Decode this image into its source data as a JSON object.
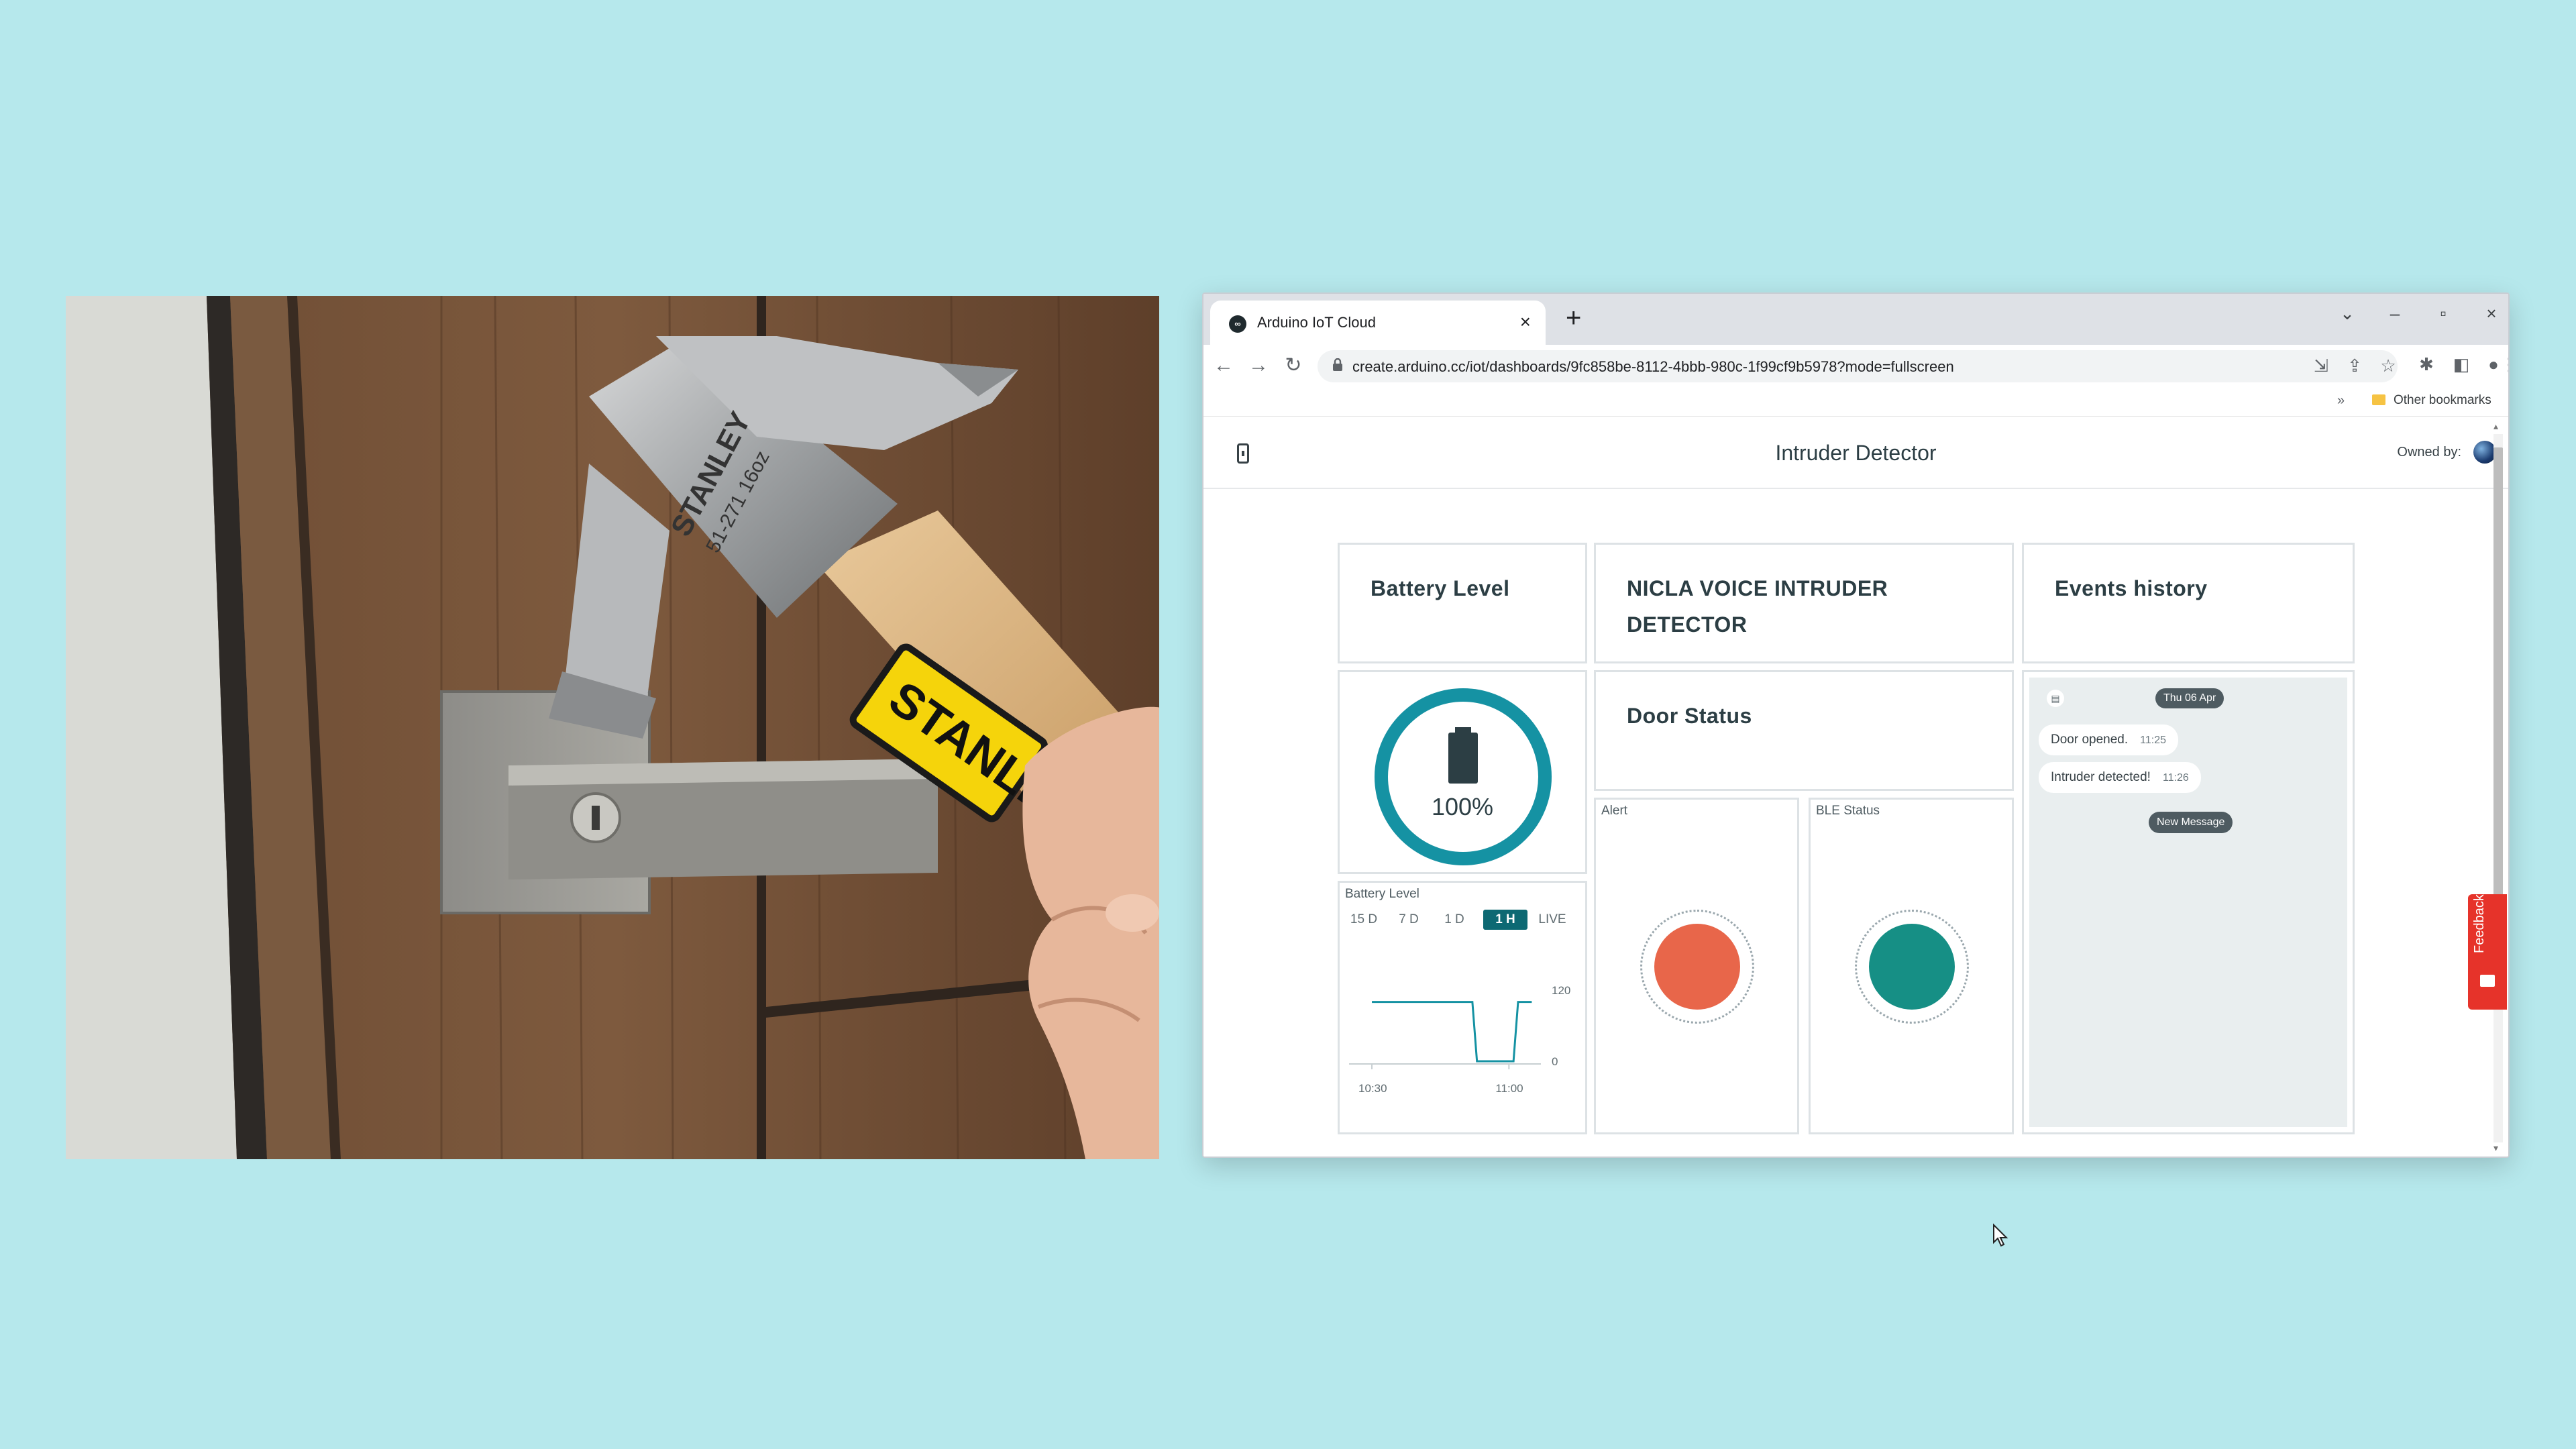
{
  "browser": {
    "tab_title": "Arduino IoT Cloud",
    "url": "create.arduino.cc/iot/dashboards/9fc858be-8112-4bbb-980c-1f99cf9b5978?mode=fullscreen",
    "bookmarks_label": "Other bookmarks"
  },
  "dashboard": {
    "title": "Intruder Detector",
    "owned_by": "Owned by:",
    "cards": {
      "battery_title": "Battery Level",
      "nicla_title": "NICLA VOICE INTRUDER DETECTOR",
      "events_title": "Events history",
      "door_title": "Door Status"
    },
    "gauge": {
      "value_label": "100%",
      "value": 1.0
    },
    "battery_chart": {
      "label": "Battery Level",
      "timeframes": [
        "15 D",
        "7 D",
        "1 D",
        "1 H",
        "LIVE"
      ],
      "active_timeframe": "1 H"
    },
    "alert": {
      "label": "Alert",
      "color": "#e8664a"
    },
    "ble": {
      "label": "BLE Status",
      "color": "#168f85"
    },
    "events": {
      "date": "Thu 06 Apr",
      "messages": [
        {
          "text": "Door opened.",
          "time": "11:25"
        },
        {
          "text": "Intruder detected!",
          "time": "11:26"
        }
      ],
      "new_message": "New Message"
    },
    "feedback_label": "Feedback"
  },
  "photo": {
    "hammer_text": "STANLE",
    "hammer_head_text": "STANLEY",
    "hammer_model": "51-271 16oz"
  },
  "chart_data": {
    "type": "line",
    "title": "Battery Level",
    "x_ticks": [
      "10:30",
      "11:00"
    ],
    "y_ticks": [
      120,
      0
    ],
    "ylim": [
      0,
      120
    ],
    "series": [
      {
        "x": [
          "10:30",
          "10:48",
          "10:52",
          "10:53",
          "11:01",
          "11:02",
          "11:05"
        ],
        "values": [
          100,
          100,
          100,
          0,
          0,
          100,
          100
        ]
      }
    ]
  },
  "colors": {
    "accent": "#0d6973",
    "gauge": "#1592a3",
    "feedback": "#e6332a",
    "background": "#b6e8ec"
  }
}
